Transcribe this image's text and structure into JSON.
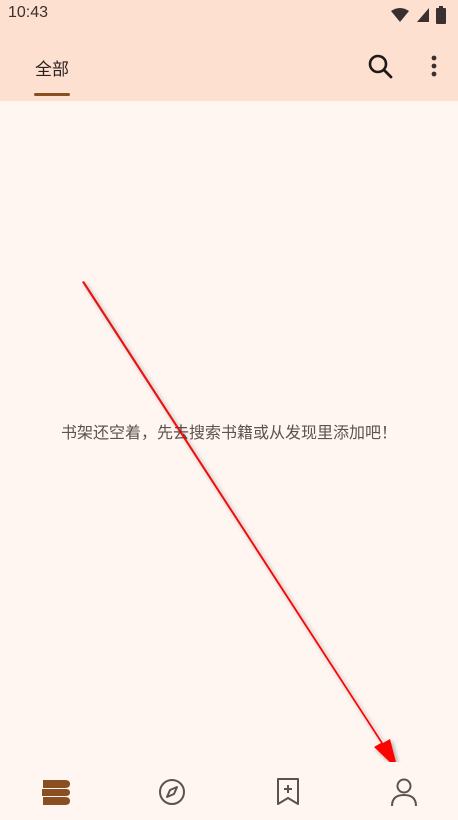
{
  "status_bar": {
    "time": "10:43",
    "icons": [
      "wifi-icon",
      "signal-icon",
      "battery-icon"
    ]
  },
  "app_bar": {
    "tab_label": "全部",
    "actions": [
      "search-icon",
      "more-vert-icon"
    ]
  },
  "main": {
    "empty_message": "书架还空着，先去搜索书籍或从发现里添加吧！"
  },
  "bottom_nav": {
    "items": [
      {
        "icon": "bookshelf-icon",
        "selected": true
      },
      {
        "icon": "compass-icon",
        "selected": false
      },
      {
        "icon": "bookmark-add-icon",
        "selected": false
      },
      {
        "icon": "person-icon",
        "selected": false
      }
    ]
  },
  "colors": {
    "header_bg": "#fde0cf",
    "body_bg": "#fff6f2",
    "accent": "#8a4f20",
    "annotation_arrow": "#e30000"
  }
}
